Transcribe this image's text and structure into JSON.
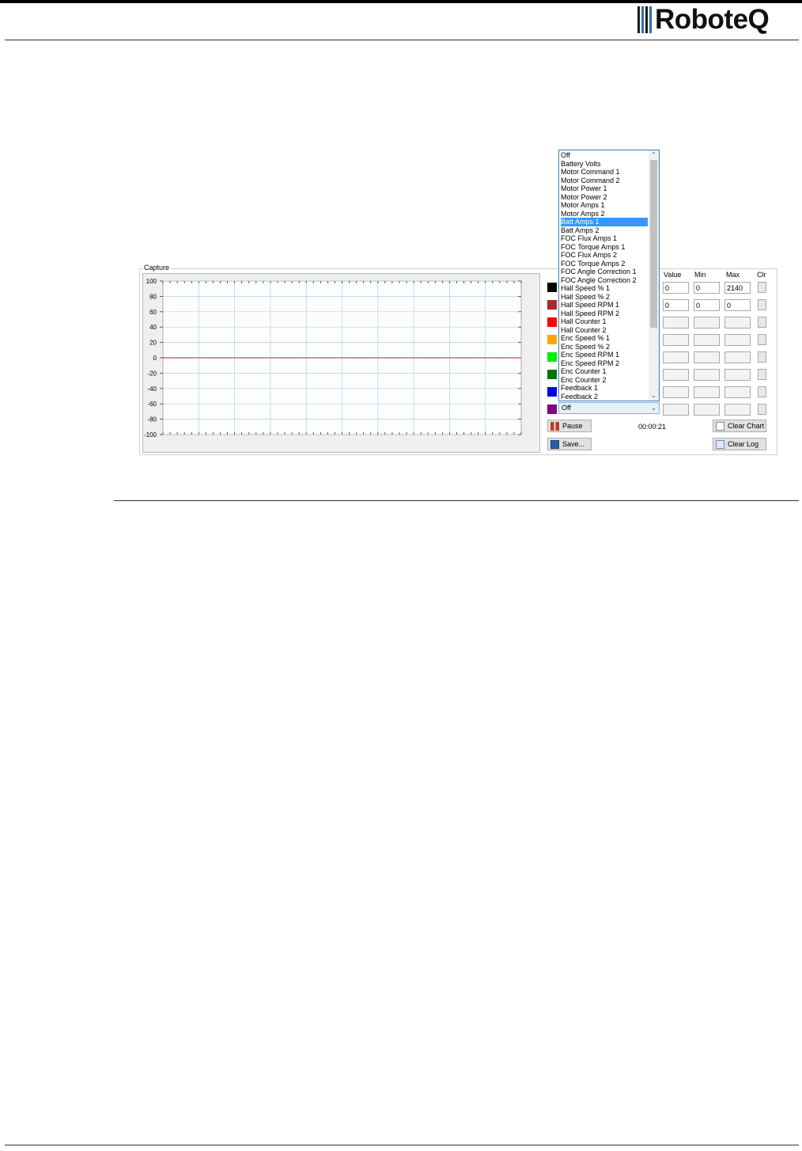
{
  "header": {
    "logo_text": "RoboteQ"
  },
  "capture": {
    "label": "Capture",
    "y_ticks": [
      "100",
      "80",
      "60",
      "40",
      "20",
      "0",
      "-20",
      "-40",
      "-60",
      "-80",
      "-100"
    ]
  },
  "table": {
    "headers": {
      "value": "Value",
      "min": "Min",
      "max": "Max",
      "clr": "Clr"
    },
    "rows": [
      {
        "color": "#000000",
        "value": "0",
        "min": "0",
        "max": "2140"
      },
      {
        "color": "#a52a2a",
        "value": "0",
        "min": "0",
        "max": "0"
      },
      {
        "color": "#ff0000",
        "value": "",
        "min": "",
        "max": ""
      },
      {
        "color": "#ffa500",
        "value": "",
        "min": "",
        "max": ""
      },
      {
        "color": "#00ee00",
        "value": "",
        "min": "",
        "max": ""
      },
      {
        "color": "#007700",
        "value": "",
        "min": "",
        "max": ""
      },
      {
        "color": "#0000ee",
        "value": "",
        "min": "",
        "max": ""
      },
      {
        "color": "#800080",
        "value": "",
        "min": "",
        "max": ""
      }
    ]
  },
  "dropdown": {
    "selected_index": 8,
    "options": [
      "Off",
      "Battery Volts",
      "Motor Command 1",
      "Motor Command 2",
      "Motor Power 1",
      "Motor Power 2",
      "Motor Amps 1",
      "Motor Amps 2",
      "Batt Amps 1",
      "Batt Amps 2",
      "FOC Flux Amps 1",
      "FOC Torque Amps 1",
      "FOC Flux Amps 2",
      "FOC Torque Amps 2",
      "FOC Angle Correction 1",
      "FOC Angle Correction 2",
      "Hall Speed % 1",
      "Hall Speed % 2",
      "Hall Speed RPM 1",
      "Hall Speed RPM 2",
      "Hall Counter 1",
      "Hall Counter 2",
      "Enc Speed % 1",
      "Enc Speed % 2",
      "Enc Speed RPM 1",
      "Enc Speed RPM 2",
      "Enc Counter 1",
      "Enc Counter 2",
      "Feedback 1",
      "Feedback 2"
    ]
  },
  "combo": {
    "value": "Off"
  },
  "controls": {
    "pause_label": "Pause",
    "save_label": "Save...",
    "timer": "00:00:21",
    "clear_chart_label": "Clear Chart",
    "clear_log_label": "Clear Log"
  },
  "colors": {
    "trace": "#b22222",
    "grid": "#a9d3e6",
    "accent": "#3399ff"
  }
}
